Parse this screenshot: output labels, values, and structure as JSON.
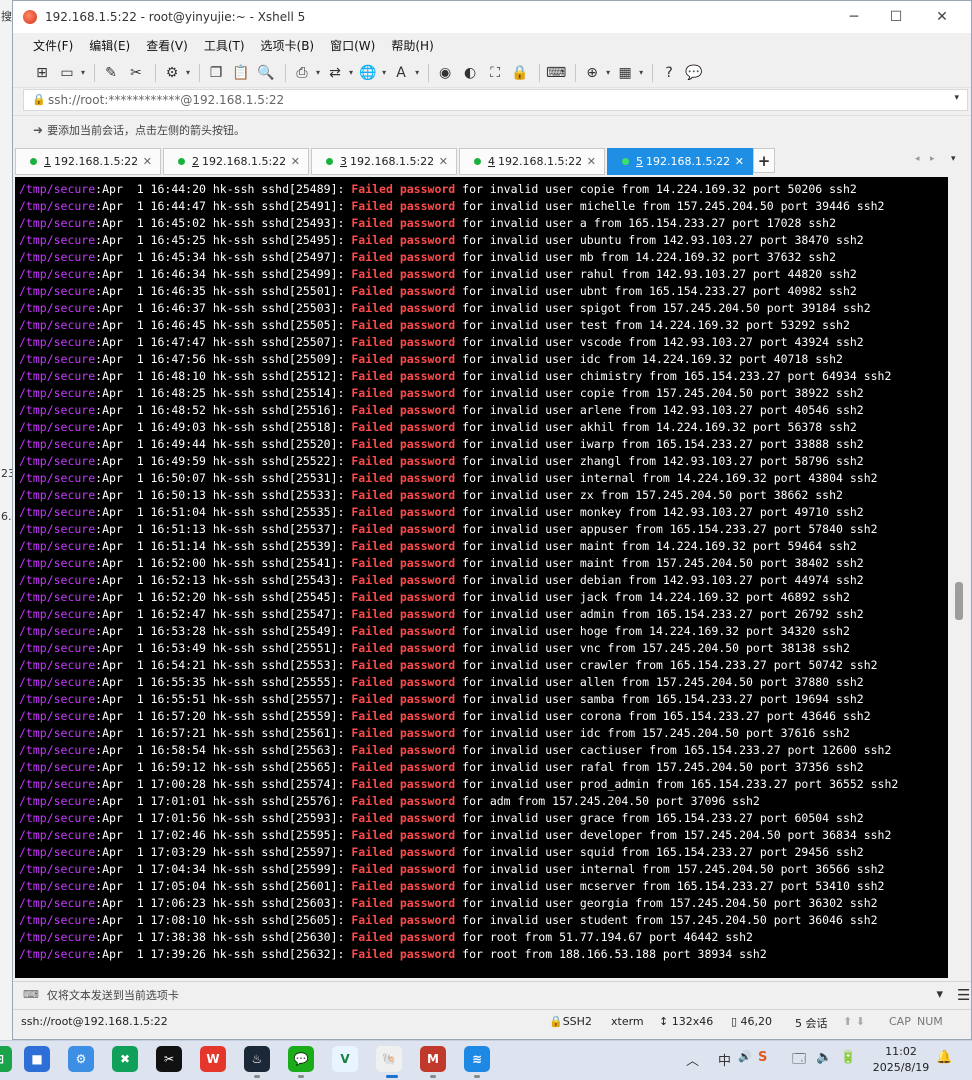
{
  "window": {
    "title": "192.168.1.5:22 - root@yinyujie:~ - Xshell 5",
    "minimize": "─",
    "maximize": "☐",
    "close": "✕"
  },
  "background": {
    "chars": [
      "搜",
      "23",
      "6."
    ]
  },
  "menu": [
    "文件(F)",
    "编辑(E)",
    "查看(V)",
    "工具(T)",
    "选项卡(B)",
    "窗口(W)",
    "帮助(H)"
  ],
  "toolbar": {
    "new_session": "⊞",
    "open": "▭",
    "reconnect": "✎",
    "disconnect": "✂",
    "properties": "⚙",
    "copy": "❐",
    "paste": "📋",
    "find": "🔍",
    "print": "⎙",
    "transfer": "⇄",
    "globe": "🌐",
    "font": "A",
    "xftp": "◉",
    "xftp2": "◐",
    "fullscreen": "⛶",
    "lock": "🔒",
    "keyboard": "⌨",
    "new_tab": "⊕",
    "layout": "▦",
    "help": "?",
    "chat": "💬",
    "dropdown": "▾"
  },
  "address": {
    "value": "ssh://root:************@192.168.1.5:22",
    "lock": "🔒",
    "dropdown": "▾"
  },
  "hint": {
    "icon": "➜",
    "text": "要添加当前会话，点击左侧的箭头按钮。"
  },
  "tabs": [
    {
      "num": "1",
      "label": "192.168.1.5:22",
      "close": "✕"
    },
    {
      "num": "2",
      "label": "192.168.1.5:22",
      "close": "✕"
    },
    {
      "num": "3",
      "label": "192.168.1.5:22",
      "close": "✕"
    },
    {
      "num": "4",
      "label": "192.168.1.5:22",
      "close": "✕"
    },
    {
      "num": "5",
      "label": "192.168.1.5:22",
      "close": "✕"
    }
  ],
  "tab_add": "+",
  "tab_nav": {
    "prev": "◂",
    "next": "▸",
    "menu": "▾"
  },
  "terminal": {
    "path": "/tmp/secure",
    "failed": "Failed password",
    "lines": [
      {
        "pre": ":Apr  1 16:44:20 hk-ssh sshd[25489]: ",
        "post": " for invalid user copie from 14.224.169.32 port 50206 ssh2"
      },
      {
        "pre": ":Apr  1 16:44:47 hk-ssh sshd[25491]: ",
        "post": " for invalid user michelle from 157.245.204.50 port 39446 ssh2"
      },
      {
        "pre": ":Apr  1 16:45:02 hk-ssh sshd[25493]: ",
        "post": " for invalid user a from 165.154.233.27 port 17028 ssh2"
      },
      {
        "pre": ":Apr  1 16:45:25 hk-ssh sshd[25495]: ",
        "post": " for invalid user ubuntu from 142.93.103.27 port 38470 ssh2"
      },
      {
        "pre": ":Apr  1 16:45:34 hk-ssh sshd[25497]: ",
        "post": " for invalid user mb from 14.224.169.32 port 37632 ssh2"
      },
      {
        "pre": ":Apr  1 16:46:34 hk-ssh sshd[25499]: ",
        "post": " for invalid user rahul from 142.93.103.27 port 44820 ssh2"
      },
      {
        "pre": ":Apr  1 16:46:35 hk-ssh sshd[25501]: ",
        "post": " for invalid user ubnt from 165.154.233.27 port 40982 ssh2"
      },
      {
        "pre": ":Apr  1 16:46:37 hk-ssh sshd[25503]: ",
        "post": " for invalid user spigot from 157.245.204.50 port 39184 ssh2"
      },
      {
        "pre": ":Apr  1 16:46:45 hk-ssh sshd[25505]: ",
        "post": " for invalid user test from 14.224.169.32 port 53292 ssh2"
      },
      {
        "pre": ":Apr  1 16:47:47 hk-ssh sshd[25507]: ",
        "post": " for invalid user vscode from 142.93.103.27 port 43924 ssh2"
      },
      {
        "pre": ":Apr  1 16:47:56 hk-ssh sshd[25509]: ",
        "post": " for invalid user idc from 14.224.169.32 port 40718 ssh2"
      },
      {
        "pre": ":Apr  1 16:48:10 hk-ssh sshd[25512]: ",
        "post": " for invalid user chimistry from 165.154.233.27 port 64934 ssh2"
      },
      {
        "pre": ":Apr  1 16:48:25 hk-ssh sshd[25514]: ",
        "post": " for invalid user copie from 157.245.204.50 port 38922 ssh2"
      },
      {
        "pre": ":Apr  1 16:48:52 hk-ssh sshd[25516]: ",
        "post": " for invalid user arlene from 142.93.103.27 port 40546 ssh2"
      },
      {
        "pre": ":Apr  1 16:49:03 hk-ssh sshd[25518]: ",
        "post": " for invalid user akhil from 14.224.169.32 port 56378 ssh2"
      },
      {
        "pre": ":Apr  1 16:49:44 hk-ssh sshd[25520]: ",
        "post": " for invalid user iwarp from 165.154.233.27 port 33888 ssh2"
      },
      {
        "pre": ":Apr  1 16:49:59 hk-ssh sshd[25522]: ",
        "post": " for invalid user zhangl from 142.93.103.27 port 58796 ssh2"
      },
      {
        "pre": ":Apr  1 16:50:07 hk-ssh sshd[25531]: ",
        "post": " for invalid user internal from 14.224.169.32 port 43804 ssh2"
      },
      {
        "pre": ":Apr  1 16:50:13 hk-ssh sshd[25533]: ",
        "post": " for invalid user zx from 157.245.204.50 port 38662 ssh2"
      },
      {
        "pre": ":Apr  1 16:51:04 hk-ssh sshd[25535]: ",
        "post": " for invalid user monkey from 142.93.103.27 port 49710 ssh2"
      },
      {
        "pre": ":Apr  1 16:51:13 hk-ssh sshd[25537]: ",
        "post": " for invalid user appuser from 165.154.233.27 port 57840 ssh2"
      },
      {
        "pre": ":Apr  1 16:51:14 hk-ssh sshd[25539]: ",
        "post": " for invalid user maint from 14.224.169.32 port 59464 ssh2"
      },
      {
        "pre": ":Apr  1 16:52:00 hk-ssh sshd[25541]: ",
        "post": " for invalid user maint from 157.245.204.50 port 38402 ssh2"
      },
      {
        "pre": ":Apr  1 16:52:13 hk-ssh sshd[25543]: ",
        "post": " for invalid user debian from 142.93.103.27 port 44974 ssh2"
      },
      {
        "pre": ":Apr  1 16:52:20 hk-ssh sshd[25545]: ",
        "post": " for invalid user jack from 14.224.169.32 port 46892 ssh2"
      },
      {
        "pre": ":Apr  1 16:52:47 hk-ssh sshd[25547]: ",
        "post": " for invalid user admin from 165.154.233.27 port 26792 ssh2"
      },
      {
        "pre": ":Apr  1 16:53:28 hk-ssh sshd[25549]: ",
        "post": " for invalid user hoge from 14.224.169.32 port 34320 ssh2"
      },
      {
        "pre": ":Apr  1 16:53:49 hk-ssh sshd[25551]: ",
        "post": " for invalid user vnc from 157.245.204.50 port 38138 ssh2"
      },
      {
        "pre": ":Apr  1 16:54:21 hk-ssh sshd[25553]: ",
        "post": " for invalid user crawler from 165.154.233.27 port 50742 ssh2"
      },
      {
        "pre": ":Apr  1 16:55:35 hk-ssh sshd[25555]: ",
        "post": " for invalid user allen from 157.245.204.50 port 37880 ssh2"
      },
      {
        "pre": ":Apr  1 16:55:51 hk-ssh sshd[25557]: ",
        "post": " for invalid user samba from 165.154.233.27 port 19694 ssh2"
      },
      {
        "pre": ":Apr  1 16:57:20 hk-ssh sshd[25559]: ",
        "post": " for invalid user corona from 165.154.233.27 port 43646 ssh2"
      },
      {
        "pre": ":Apr  1 16:57:21 hk-ssh sshd[25561]: ",
        "post": " for invalid user idc from 157.245.204.50 port 37616 ssh2"
      },
      {
        "pre": ":Apr  1 16:58:54 hk-ssh sshd[25563]: ",
        "post": " for invalid user cactiuser from 165.154.233.27 port 12600 ssh2"
      },
      {
        "pre": ":Apr  1 16:59:12 hk-ssh sshd[25565]: ",
        "post": " for invalid user rafal from 157.245.204.50 port 37356 ssh2"
      },
      {
        "pre": ":Apr  1 17:00:28 hk-ssh sshd[25574]: ",
        "post": " for invalid user prod_admin from 165.154.233.27 port 36552 ssh2"
      },
      {
        "pre": ":Apr  1 17:01:01 hk-ssh sshd[25576]: ",
        "post": " for adm from 157.245.204.50 port 37096 ssh2"
      },
      {
        "pre": ":Apr  1 17:01:56 hk-ssh sshd[25593]: ",
        "post": " for invalid user grace from 165.154.233.27 port 60504 ssh2"
      },
      {
        "pre": ":Apr  1 17:02:46 hk-ssh sshd[25595]: ",
        "post": " for invalid user developer from 157.245.204.50 port 36834 ssh2"
      },
      {
        "pre": ":Apr  1 17:03:29 hk-ssh sshd[25597]: ",
        "post": " for invalid user squid from 165.154.233.27 port 29456 ssh2"
      },
      {
        "pre": ":Apr  1 17:04:34 hk-ssh sshd[25599]: ",
        "post": " for invalid user internal from 157.245.204.50 port 36566 ssh2"
      },
      {
        "pre": ":Apr  1 17:05:04 hk-ssh sshd[25601]: ",
        "post": " for invalid user mcserver from 165.154.233.27 port 53410 ssh2"
      },
      {
        "pre": ":Apr  1 17:06:23 hk-ssh sshd[25603]: ",
        "post": " for invalid user georgia from 157.245.204.50 port 36302 ssh2"
      },
      {
        "pre": ":Apr  1 17:08:10 hk-ssh sshd[25605]: ",
        "post": " for invalid user student from 157.245.204.50 port 36046 ssh2"
      },
      {
        "pre": ":Apr  1 17:38:38 hk-ssh sshd[25630]: ",
        "post": " for root from 51.77.194.67 port 46442 ssh2"
      },
      {
        "pre": ":Apr  1 17:39:26 hk-ssh sshd[25632]: ",
        "post": " for root from 188.166.53.188 port 38934 ssh2"
      }
    ]
  },
  "sendbar": {
    "icon": "⌨",
    "text": "仅将文本发送到当前选项卡",
    "menu": "▾",
    "burger": "☰"
  },
  "status": {
    "address": "ssh://root@192.168.1.5:22",
    "protocol": "🔒SSH2",
    "term": "xterm",
    "size": "↕ 132x46",
    "cursor": "▯ 46,20",
    "sessions": "5 会话",
    "arrows": "⬆ ⬇",
    "caps": "CAP",
    "num": "NUM"
  },
  "taskbar": {
    "apps": [
      "⊞",
      "■",
      "⚙",
      "✖",
      "✂",
      "W",
      "♨",
      "💬",
      "V",
      "🐚",
      "M",
      "≋"
    ],
    "tray": [
      "︿",
      "中",
      "🔊",
      "S",
      "🗔",
      "🔈",
      "🔋"
    ],
    "time": "11:02",
    "date": "2025/8/19",
    "notify": "🔔"
  },
  "colors": {
    "path": "#c738ff",
    "failed": "#ff4a4a",
    "active_tab": "#1f8fe5",
    "terminal_bg": "#000000"
  }
}
